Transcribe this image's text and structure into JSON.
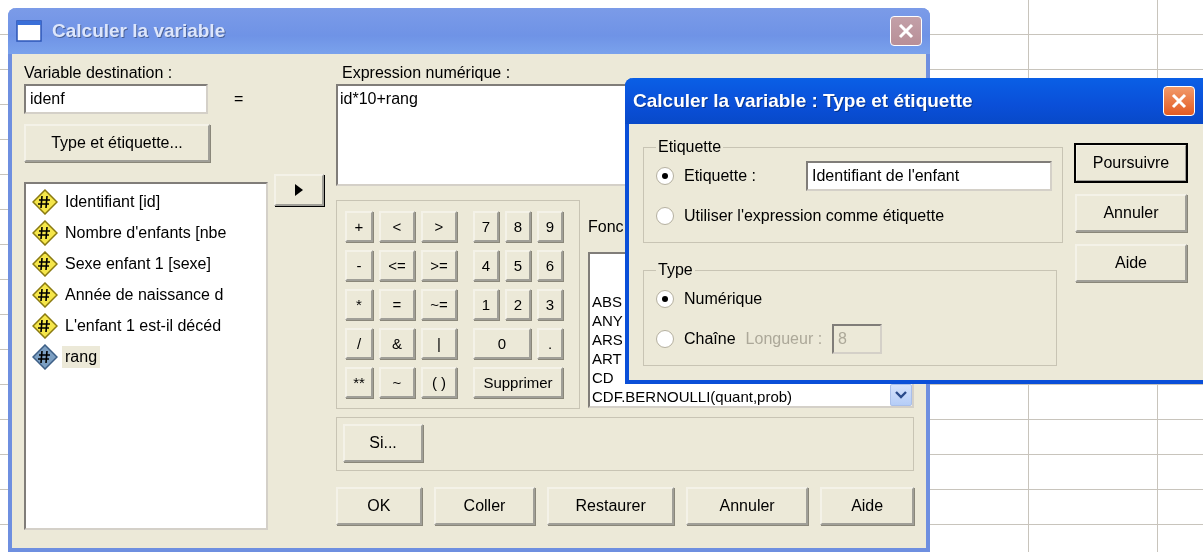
{
  "main_window": {
    "title": "Calculer la variable",
    "target": {
      "label": "Variable destination :",
      "value": "idenf"
    },
    "equals": "=",
    "type_button": "Type et étiquette...",
    "variables": [
      {
        "label": "Identifiant [id]",
        "selected": false
      },
      {
        "label": "Nombre d'enfants [nbe",
        "selected": false
      },
      {
        "label": "Sexe enfant 1 [sexe]",
        "selected": false
      },
      {
        "label": "Année de naissance d",
        "selected": false
      },
      {
        "label": "L'enfant 1 est-il décéd",
        "selected": false
      },
      {
        "label": "rang",
        "selected": true
      }
    ],
    "expression": {
      "label": "Expression numérique :",
      "value": "id*10+rang"
    },
    "keypad": {
      "operators": [
        {
          "label": "+",
          "kind": "key"
        },
        {
          "label": "<",
          "kind": "key"
        },
        {
          "label": ">",
          "kind": "key"
        },
        {
          "label": "-",
          "kind": "key"
        },
        {
          "label": "<=",
          "kind": "key"
        },
        {
          "label": ">=",
          "kind": "key"
        },
        {
          "label": "*",
          "kind": "key"
        },
        {
          "label": "=",
          "kind": "key"
        },
        {
          "label": "~=",
          "kind": "key"
        },
        {
          "label": "/",
          "kind": "key"
        },
        {
          "label": "&",
          "kind": "key"
        },
        {
          "label": "|",
          "kind": "key"
        },
        {
          "label": "**",
          "kind": "key"
        },
        {
          "label": "~",
          "kind": "key"
        },
        {
          "label": "( )",
          "kind": "key"
        }
      ],
      "digits": [
        {
          "label": "7",
          "kind": "key"
        },
        {
          "label": "8",
          "kind": "key"
        },
        {
          "label": "9",
          "kind": "key"
        },
        {
          "label": "4",
          "kind": "key"
        },
        {
          "label": "5",
          "kind": "key"
        },
        {
          "label": "6",
          "kind": "key"
        },
        {
          "label": "1",
          "kind": "key"
        },
        {
          "label": "2",
          "kind": "key"
        },
        {
          "label": "3",
          "kind": "key"
        },
        {
          "label": "0",
          "kind": "wide"
        },
        {
          "label": ".",
          "kind": "key"
        },
        {
          "label": "Supprimer",
          "kind": "full"
        }
      ]
    },
    "functions": {
      "label": "Fonc",
      "items": [
        "ABS",
        "ANY",
        "ARS",
        "ART",
        "CD",
        "CDF.BERNOULLI(quant,prob)"
      ]
    },
    "if_button": "Si...",
    "buttons": [
      "OK",
      "Coller",
      "Restaurer",
      "Annuler",
      "Aide"
    ]
  },
  "sub_window": {
    "title": "Calculer la variable : Type et étiquette",
    "label_group": {
      "legend": "Etiquette",
      "options": [
        {
          "label": "Etiquette :",
          "selected": true,
          "value": "Identifiant de l'enfant"
        },
        {
          "label": "Utiliser l'expression comme étiquette",
          "selected": false
        }
      ]
    },
    "type_group": {
      "legend": "Type",
      "options": [
        {
          "label": "Numérique",
          "selected": true
        },
        {
          "label": "Chaîne",
          "selected": false
        }
      ],
      "length": {
        "label": "Longueur :",
        "value": "8",
        "disabled": true
      }
    },
    "buttons": [
      {
        "label": "Poursuivre",
        "default": true
      },
      {
        "label": "Annuler",
        "default": false
      },
      {
        "label": "Aide",
        "default": false
      }
    ]
  }
}
